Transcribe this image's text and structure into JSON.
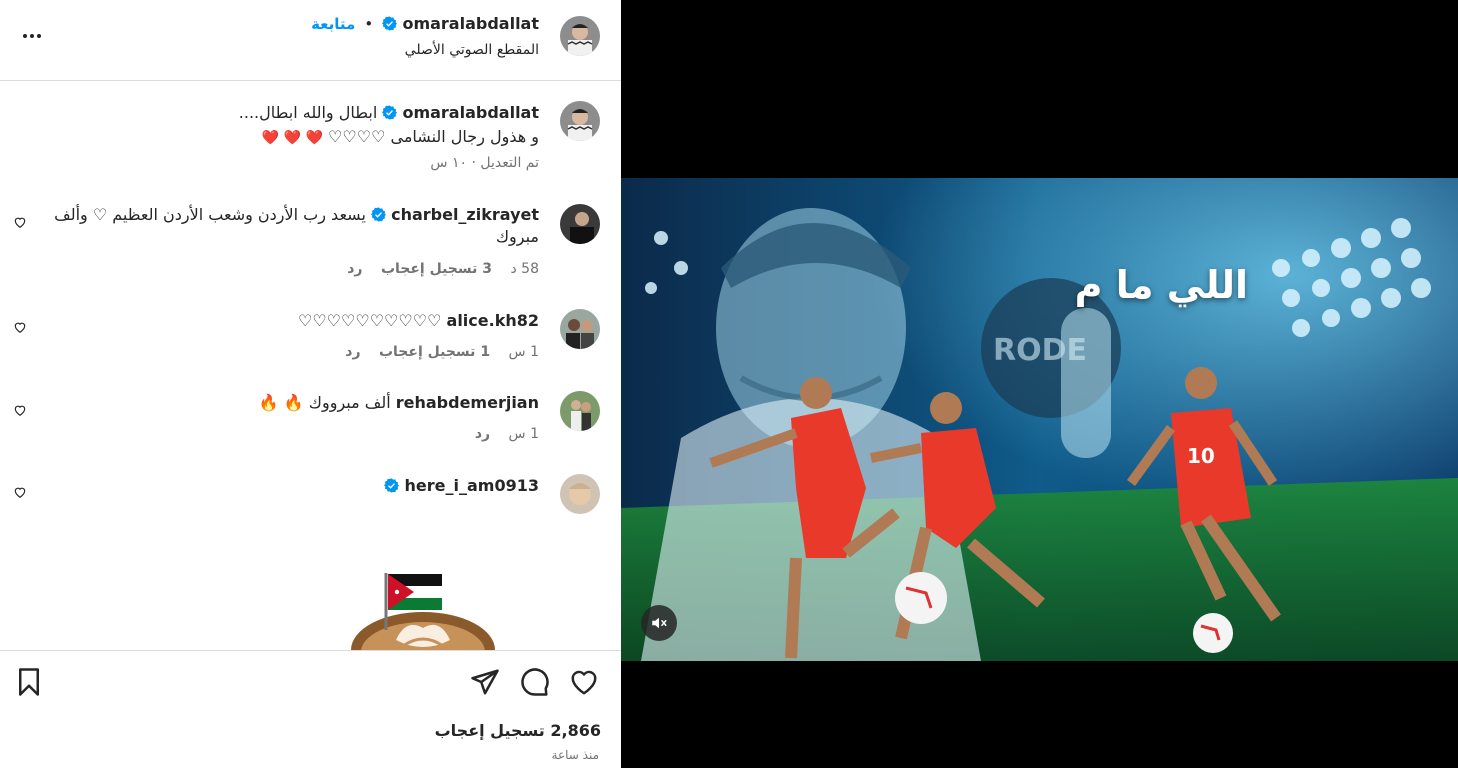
{
  "header": {
    "username": "omaralabdallat",
    "separator": "•",
    "follow_label": "متابعة",
    "audio_label": "المقطع الصوتي الأصلي"
  },
  "caption": {
    "username": "omaralabdallat",
    "line1": "ابطال والله ابطال....",
    "line2": "و هذول رجال النشامى ♡♡♡♡",
    "hearts": "❤️ ❤️ ❤️",
    "meta": "تم التعديل · ١٠ س"
  },
  "comments": [
    {
      "username": "charbel_zikrayet",
      "verified": true,
      "text_line1": "يسعد رب الأردن وشعب الأردن العظيم ♡ وألف",
      "text_line2": "مبروك",
      "time": "58 د",
      "likes": "3 تسجيل إعجاب",
      "reply": "رد"
    },
    {
      "username": "alice.kh82",
      "verified": false,
      "text_line1": "♡♡♡♡♡♡♡♡♡♡",
      "time": "1 س",
      "likes": "1 تسجيل إعجاب",
      "reply": "رد"
    },
    {
      "username": "rehabdemerjian",
      "verified": false,
      "text_line1": "ألف مبرووك",
      "emoji": "🔥 🔥",
      "time": "1 س",
      "reply": "رد"
    },
    {
      "username": "here_i_am0913",
      "verified": true
    }
  ],
  "footer": {
    "likes_count": "2,866 تسجيل إعجاب",
    "posted_ago": "منذ ساعة"
  },
  "video": {
    "overlay_text": "اللي ما م",
    "mic_brand": "RODE"
  },
  "colors": {
    "link_blue": "#0095f6",
    "verified_blue": "#0095f6",
    "muted_text": "#737373",
    "divider": "#dbdbdb",
    "heart_red": "#ed4956"
  }
}
